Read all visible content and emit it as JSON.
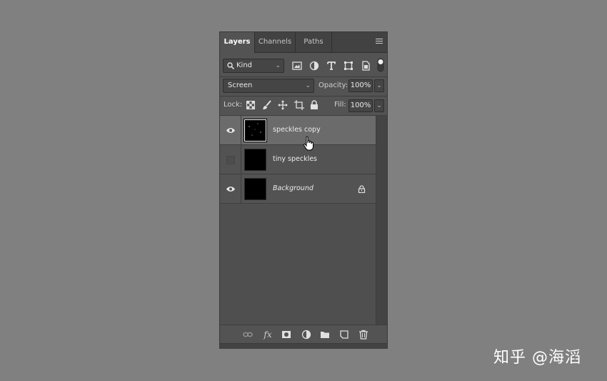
{
  "tabs": [
    {
      "label": "Layers",
      "active": true
    },
    {
      "label": "Channels",
      "active": false
    },
    {
      "label": "Paths",
      "active": false
    }
  ],
  "filter": {
    "kind_label": "Kind",
    "icons": [
      "image-filter-icon",
      "adjustment-filter-icon",
      "type-filter-icon",
      "shape-filter-icon",
      "smart-object-filter-icon",
      "filter-toggle-icon"
    ]
  },
  "blend": {
    "mode": "Screen",
    "opacity_label": "Opacity:",
    "opacity_value": "100%"
  },
  "lock": {
    "label": "Lock:",
    "icons": [
      "lock-transparent-pixels-icon",
      "lock-image-pixels-icon",
      "lock-position-icon",
      "lock-artboard-icon",
      "lock-all-icon"
    ],
    "fill_label": "Fill:",
    "fill_value": "100%"
  },
  "layers": [
    {
      "name": "speckles copy",
      "visible": true,
      "selected": true,
      "italic": false,
      "locked": false
    },
    {
      "name": "tiny speckles",
      "visible": false,
      "selected": false,
      "italic": false,
      "locked": false
    },
    {
      "name": "Background",
      "visible": true,
      "selected": false,
      "italic": true,
      "locked": true
    }
  ],
  "footer_icons": [
    "link-layers-icon",
    "fx-icon",
    "add-mask-icon",
    "new-adjustment-icon",
    "new-group-icon",
    "new-layer-icon",
    "delete-layer-icon"
  ],
  "footer_fx_label": "fx",
  "watermark": "知乎 @海滔",
  "colors": {
    "canvas_bg": "#808080",
    "panel_bg": "#535353",
    "selected_row": "#6b6b6b"
  }
}
